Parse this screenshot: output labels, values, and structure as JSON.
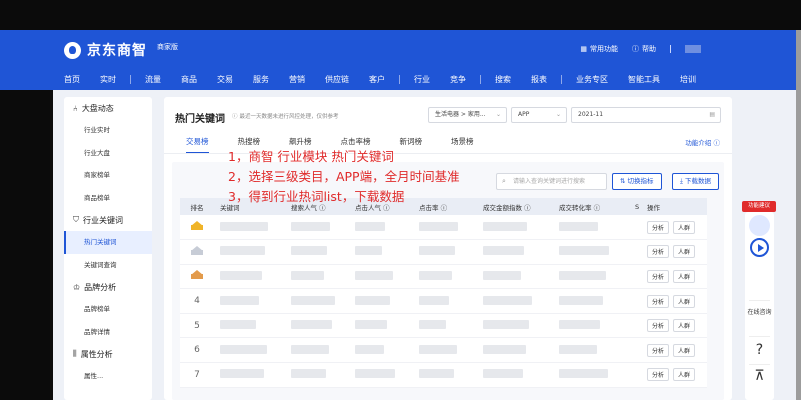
{
  "header": {
    "logo_text": "京东商智",
    "logo_badge": "商家版",
    "tools": [
      {
        "icon": "grid-icon",
        "label": "常用功能"
      },
      {
        "icon": "help-icon",
        "label": "帮助"
      }
    ],
    "nav": [
      "首页",
      "实时",
      "流量",
      "商品",
      "交易",
      "服务",
      "营销",
      "供应链",
      "客户",
      "行业",
      "竞争",
      "搜索",
      "报表",
      "业务专区",
      "智能工具",
      "培训"
    ],
    "nav_active": "行业"
  },
  "sidebar": {
    "groups": [
      {
        "icon": "大盘动态",
        "label": "大盘动态",
        "items": [
          "行业实时",
          "行业大盘",
          "商家榜单",
          "商品榜单"
        ]
      },
      {
        "icon": "行业关键词",
        "label": "行业关键词",
        "items": [
          "热门关键词",
          "关键词查询"
        ]
      },
      {
        "icon": "品牌分析",
        "label": "品牌分析",
        "items": [
          "品牌榜单",
          "品牌详情"
        ]
      },
      {
        "icon": "属性分析",
        "label": "属性分析",
        "items": [
          "属性..."
        ]
      }
    ],
    "active_item": "热门关键词"
  },
  "content": {
    "title": "热门关键词",
    "hint": "最近一天数据未进行风控处理，仅供参考",
    "category_select": "生活电器 > 家用...",
    "platform_select": "APP",
    "date_select": "2021-11",
    "tabs": [
      "交易榜",
      "热搜榜",
      "飙升榜",
      "点击率榜",
      "新词榜",
      "场景榜"
    ],
    "active_tab": "交易榜",
    "func_intro": "功能介绍 ⓘ",
    "search_placeholder": "请输入查询关键词进行搜索",
    "switch_button": "切换指标",
    "download_button": "下载数据",
    "table": {
      "headers": [
        "排名",
        "关键词",
        "搜索人气 ⓘ",
        "点击人气 ⓘ",
        "点击率 ⓘ",
        "成交金额指数 ⓘ",
        "成交转化率 ⓘ",
        "S",
        "操作"
      ],
      "ranks": [
        "1",
        "2",
        "3",
        "4",
        "5",
        "6",
        "7"
      ],
      "action_analyze": "分析",
      "action_crowd": "人群"
    }
  },
  "annotation": {
    "lines": [
      "1，商智 行业模块 热门关键词",
      "2，选择三级类目，APP端，全月时间基准",
      "3，得到行业热词list，下载数据"
    ],
    "color": "#e02b2b"
  },
  "right_panel": {
    "feedback": "功能建议",
    "consult": "在线咨询",
    "help_glyph": "?",
    "top_glyph": "⊼"
  },
  "colors": {
    "brand": "#1f55d6",
    "accent_red": "#e02b2b"
  }
}
